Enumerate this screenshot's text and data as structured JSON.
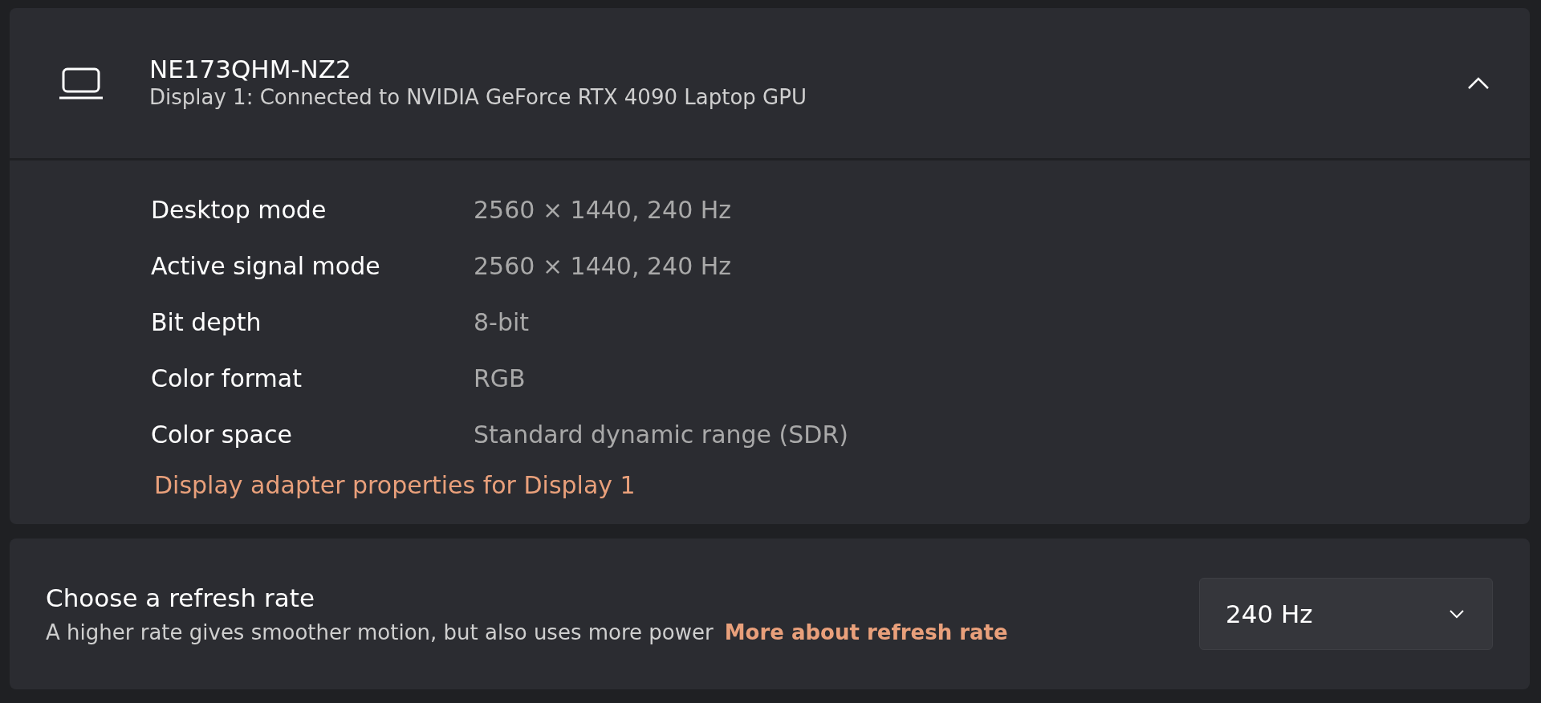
{
  "display": {
    "name": "NE173QHM-NZ2",
    "subtitle": "Display 1: Connected to NVIDIA GeForce RTX 4090 Laptop GPU",
    "expanded": true,
    "properties": [
      {
        "label": "Desktop mode",
        "value": "2560 × 1440, 240 Hz"
      },
      {
        "label": "Active signal mode",
        "value": "2560 × 1440, 240 Hz"
      },
      {
        "label": "Bit depth",
        "value": "8-bit"
      },
      {
        "label": "Color format",
        "value": "RGB"
      },
      {
        "label": "Color space",
        "value": "Standard dynamic range (SDR)"
      }
    ],
    "adapter_link": "Display adapter properties for Display 1"
  },
  "refresh_rate": {
    "title": "Choose a refresh rate",
    "description": "A higher rate gives smoother motion, but also uses more power",
    "link": "More about refresh rate",
    "selected_value": "240 Hz"
  }
}
